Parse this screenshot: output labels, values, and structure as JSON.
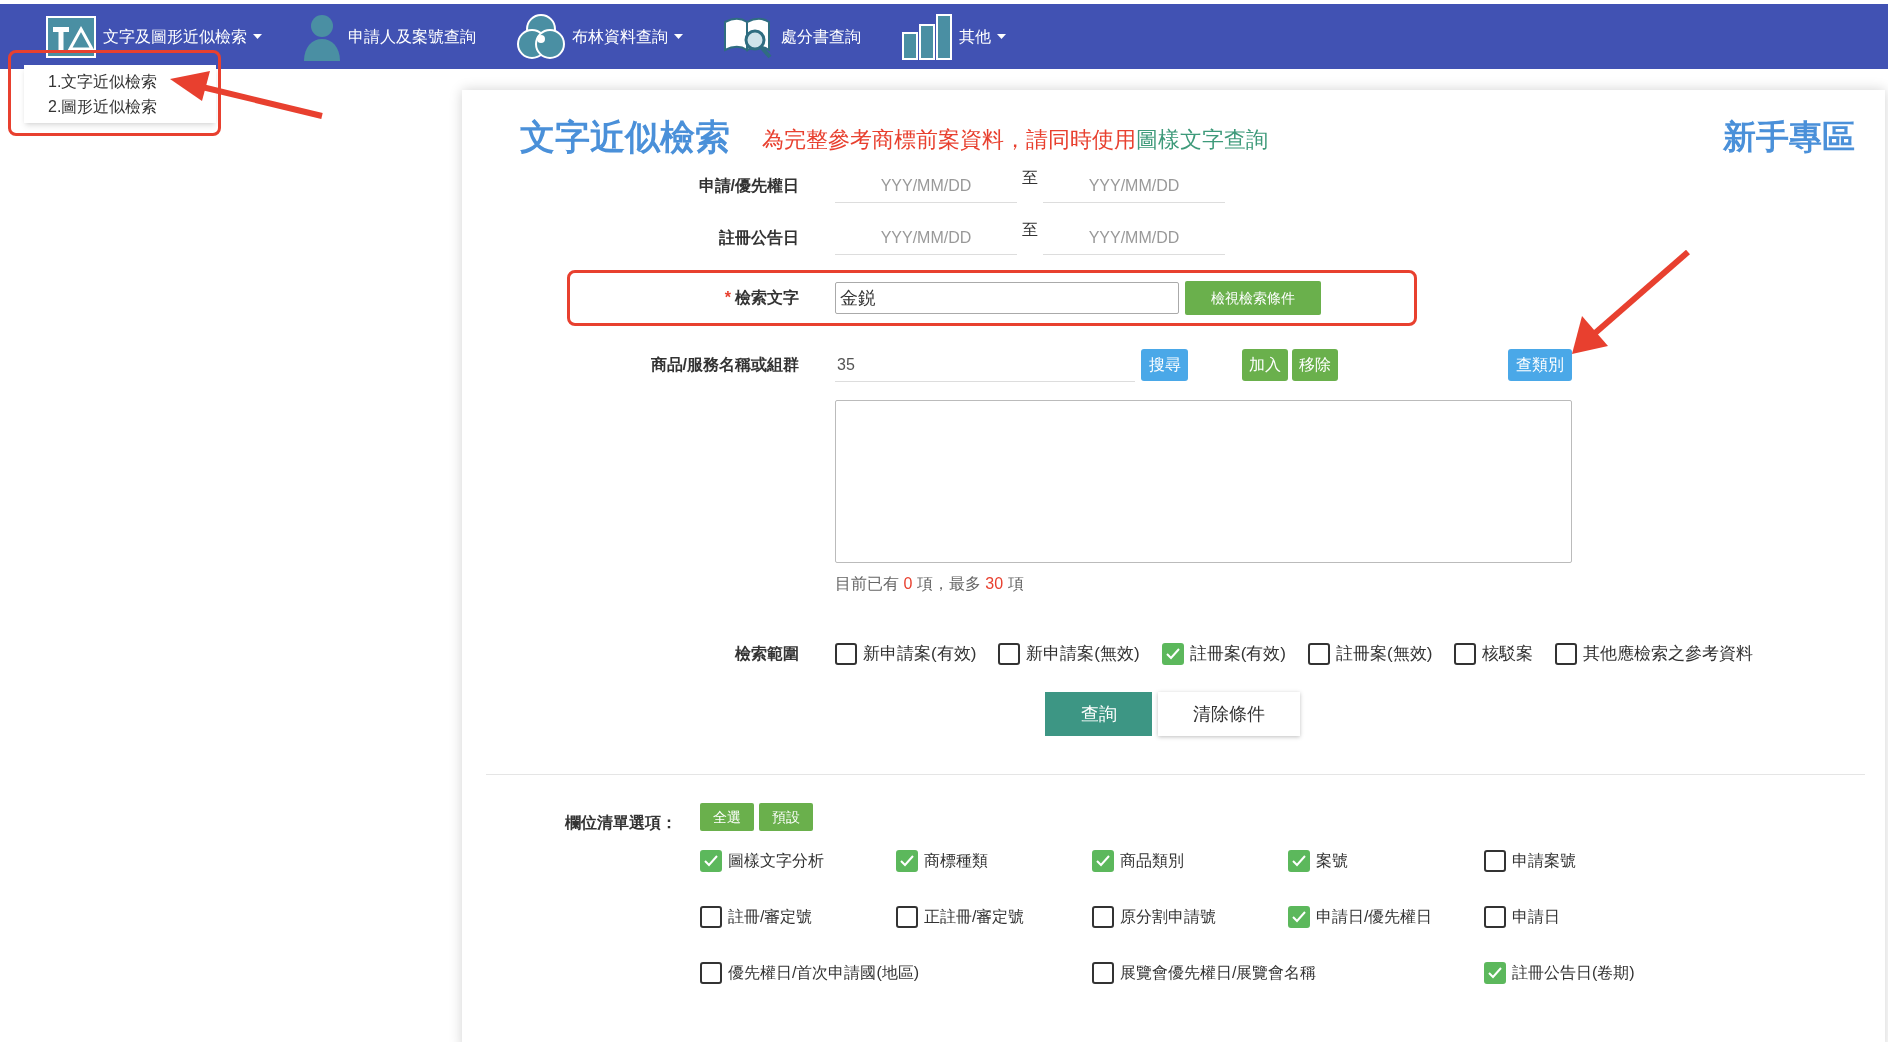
{
  "nav": {
    "items": [
      {
        "label": "文字及圖形近似檢索",
        "caret": true
      },
      {
        "label": "申請人及案號查詢",
        "caret": false
      },
      {
        "label": "布林資料查詢",
        "caret": true
      },
      {
        "label": "處分書查詢",
        "caret": false
      },
      {
        "label": "其他",
        "caret": true
      }
    ]
  },
  "dropdown": {
    "items": [
      "1.文字近似檢索",
      "2.圖形近似檢索"
    ]
  },
  "page": {
    "title": "文字近似檢索",
    "notice": "為完整參考商標前案資料，請同時使用",
    "notice_link": "圖樣文字查詢",
    "help_link": "新手專區"
  },
  "form": {
    "app_date": {
      "label": "申請/優先權日",
      "from_placeholder": "YYY/MM/DD",
      "to": "至",
      "to_placeholder": "YYY/MM/DD"
    },
    "pub_date": {
      "label": "註冊公告日",
      "from_placeholder": "YYY/MM/DD",
      "to": "至",
      "to_placeholder": "YYY/MM/DD"
    },
    "search_text": {
      "required_mark": "*",
      "label": "檢索文字",
      "value": "金鋭",
      "button": "檢視檢索條件"
    },
    "goods": {
      "label": "商品/服務名稱或組群",
      "value": "35",
      "search_button": "搜尋",
      "add_button": "加入",
      "remove_button": "移除",
      "class_button": "查類別"
    },
    "count": {
      "prefix": "目前已有",
      "current": "0",
      "middle": "項，最多",
      "max": "30",
      "suffix": "項"
    },
    "scope": {
      "label": "檢索範圍",
      "options": [
        {
          "label": "新申請案(有效)",
          "checked": false
        },
        {
          "label": "新申請案(無效)",
          "checked": false
        },
        {
          "label": "註冊案(有效)",
          "checked": true
        },
        {
          "label": "註冊案(無效)",
          "checked": false
        },
        {
          "label": "核駁案",
          "checked": false
        },
        {
          "label": "其他應檢索之參考資料",
          "checked": false
        }
      ]
    },
    "submit": "查詢",
    "clear": "清除條件"
  },
  "columns": {
    "label": "欄位清單選項：",
    "select_all": "全選",
    "default": "預設",
    "options": [
      {
        "label": "圖樣文字分析",
        "checked": true
      },
      {
        "label": "商標種類",
        "checked": true
      },
      {
        "label": "商品類別",
        "checked": true
      },
      {
        "label": "案號",
        "checked": true
      },
      {
        "label": "申請案號",
        "checked": false
      },
      {
        "label": "註冊/審定號",
        "checked": false
      },
      {
        "label": "正註冊/審定號",
        "checked": false
      },
      {
        "label": "原分割申請號",
        "checked": false
      },
      {
        "label": "申請日/優先權日",
        "checked": true
      },
      {
        "label": "申請日",
        "checked": false
      },
      {
        "label": "優先權日/首次申請國(地區)",
        "checked": false
      },
      {
        "label": "展覽會優先權日/展覽會名稱",
        "checked": false
      },
      {
        "label": "註冊公告日(卷期)",
        "checked": true
      }
    ]
  }
}
